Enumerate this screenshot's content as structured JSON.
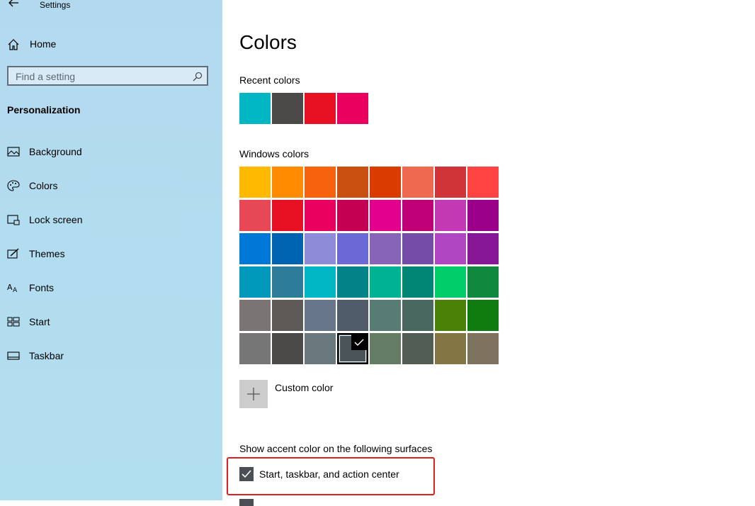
{
  "window": {
    "title": "Settings"
  },
  "sidebar": {
    "home_label": "Home",
    "search_placeholder": "Find a setting",
    "section_title": "Personalization",
    "items": [
      {
        "label": "Background",
        "icon": "picture-icon"
      },
      {
        "label": "Colors",
        "icon": "palette-icon"
      },
      {
        "label": "Lock screen",
        "icon": "lock-screen-icon"
      },
      {
        "label": "Themes",
        "icon": "brush-icon"
      },
      {
        "label": "Fonts",
        "icon": "font-icon"
      },
      {
        "label": "Start",
        "icon": "start-icon"
      },
      {
        "label": "Taskbar",
        "icon": "taskbar-icon"
      }
    ]
  },
  "main": {
    "title": "Colors",
    "recent_label": "Recent colors",
    "recent_colors": [
      "#00b7c3",
      "#4c4a48",
      "#e81123",
      "#ea005e"
    ],
    "windows_label": "Windows colors",
    "windows_colors": [
      [
        "#ffb900",
        "#ff8c00",
        "#f7630c",
        "#ca5010",
        "#da3b01",
        "#ef6950",
        "#d13438",
        "#ff4343"
      ],
      [
        "#e74856",
        "#e81123",
        "#ea005e",
        "#c30052",
        "#e3008c",
        "#bf0077",
        "#c239b3",
        "#9a0089"
      ],
      [
        "#0078d7",
        "#0063b1",
        "#8e8cd8",
        "#6b69d6",
        "#8764b8",
        "#744da9",
        "#b146c2",
        "#881798"
      ],
      [
        "#0099bc",
        "#2d7d9a",
        "#00b7c3",
        "#038387",
        "#00b294",
        "#018574",
        "#00cc6a",
        "#10893e"
      ],
      [
        "#7a7574",
        "#5d5a58",
        "#68768a",
        "#515c6b",
        "#567c73",
        "#486860",
        "#498205",
        "#107c10"
      ],
      [
        "#767676",
        "#4c4a48",
        "#69797e",
        "#4a5459",
        "#647c64",
        "#525e54",
        "#847545",
        "#7e735f"
      ]
    ],
    "selected_color": "#4a5459",
    "custom_color_label": "Custom color",
    "surfaces_label": "Show accent color on the following surfaces",
    "checkbox_label": "Start, taskbar, and action center",
    "checkbox_checked": true,
    "highlight_color": "#e0201f"
  }
}
